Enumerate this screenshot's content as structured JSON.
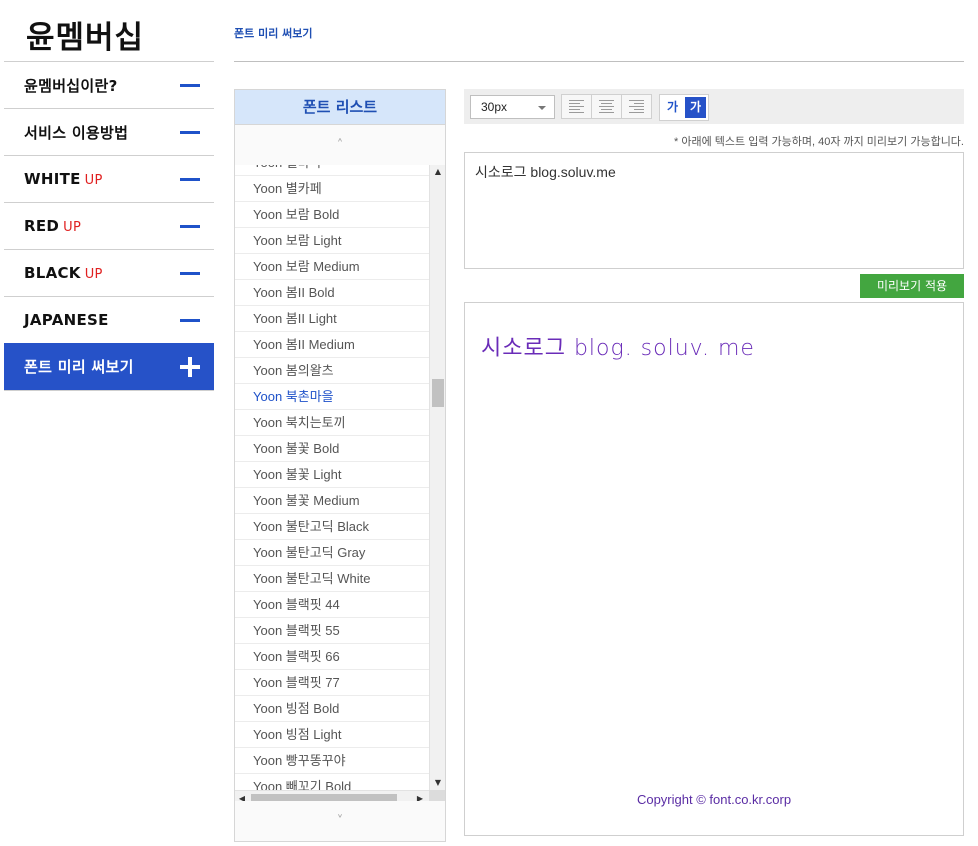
{
  "logo": "윤멤버십",
  "sidebar": {
    "items": [
      {
        "label": "윤멤버십이란?",
        "badge": ""
      },
      {
        "label": "서비스 이용방법",
        "badge": ""
      },
      {
        "label": "WHITE",
        "badge": "UP"
      },
      {
        "label": "RED",
        "badge": "UP"
      },
      {
        "label": "BLACK",
        "badge": "UP"
      },
      {
        "label": "JAPANESE",
        "badge": ""
      },
      {
        "label": "폰트 미리 써보기",
        "badge": "",
        "active": true
      }
    ]
  },
  "breadcrumb": "폰트 미리 써보기",
  "fontlist": {
    "title": "폰트 리스트",
    "items": [
      "Yoon 별바다",
      "Yoon 별카페",
      "Yoon 보람 Bold",
      "Yoon 보람 Light",
      "Yoon 보람 Medium",
      "Yoon 봄II Bold",
      "Yoon 봄II Light",
      "Yoon 봄II Medium",
      "Yoon 봄의왈츠",
      "Yoon 북촌마을",
      "Yoon 북치는토끼",
      "Yoon 불꽃 Bold",
      "Yoon 불꽃 Light",
      "Yoon 불꽃 Medium",
      "Yoon 불탄고딕 Black",
      "Yoon 불탄고딕 Gray",
      "Yoon 불탄고딕 White",
      "Yoon 블랙핏 44",
      "Yoon 블랙핏 55",
      "Yoon 블랙핏 66",
      "Yoon 블랙핏 77",
      "Yoon 빙점 Bold",
      "Yoon 빙점 Light",
      "Yoon 빵꾸똥꾸야",
      "Yoon 빼꼬기 Bold"
    ],
    "selected_index": 9
  },
  "toolbar": {
    "size_value": "30px",
    "weight_normal_label": "가",
    "weight_bold_label": "가"
  },
  "hint": "* 아래에 텍스트 입력 가능하며, 40자 까지 미리보기 가능합니다.",
  "input_text": "시소로그 blog.soluv.me",
  "apply_label": "미리보기 적용",
  "preview": {
    "text": "시소로그 blog. soluv. me",
    "copyright": "Copyright © font.co.kr.corp"
  },
  "colors": {
    "accent": "#2652c8",
    "apply": "#43a640",
    "preview_text": "#6a2cb8",
    "badge": "#e02020"
  }
}
